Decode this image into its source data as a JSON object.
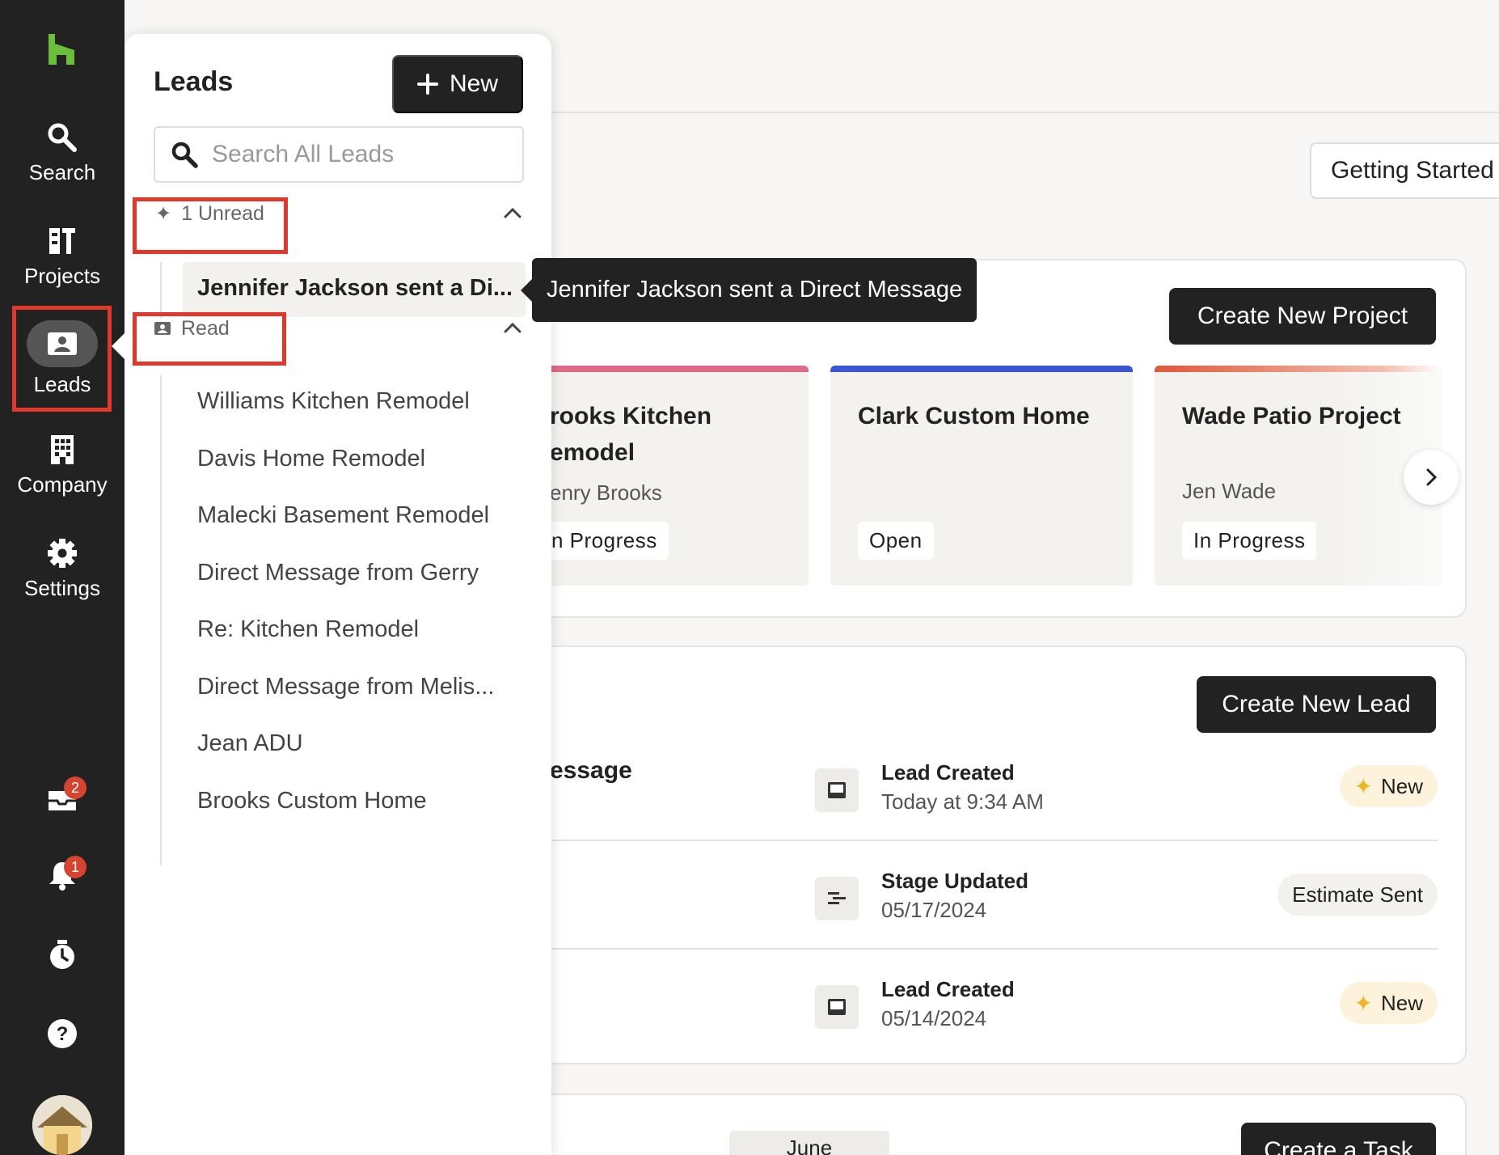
{
  "rail": {
    "items": [
      {
        "label": "Search",
        "icon": "search-icon"
      },
      {
        "label": "Projects",
        "icon": "projects-icon"
      },
      {
        "label": "Leads",
        "icon": "leads-icon"
      },
      {
        "label": "Company",
        "icon": "building-icon"
      },
      {
        "label": "Settings",
        "icon": "gear-icon"
      }
    ],
    "inbox_badge": "2",
    "bell_badge": "1"
  },
  "main": {
    "getting_started": "Getting Started",
    "create_project": "Create New Project",
    "create_lead": "Create New Lead",
    "create_task": "Create a Task",
    "month_tab": "June",
    "partial_message": "essage",
    "projects": [
      {
        "name": "Brooks Kitchen Remodel",
        "name_visible_1": "rooks Kitchen",
        "name_visible_2": "emodel",
        "client": "enry Brooks",
        "status": "n Progress",
        "bar_color": "#e06a8a"
      },
      {
        "name": "Clark Custom Home",
        "client": "",
        "status": "Open",
        "bar_color": "#3a55d6"
      },
      {
        "name": "Wade Patio Project",
        "client": "Jen Wade",
        "status": "In Progress",
        "bar_color": "#e0573a"
      }
    ],
    "activity": [
      {
        "title": "Lead Created",
        "sub": "Today at 9:34 AM",
        "tag": "New"
      },
      {
        "title": "Stage Updated",
        "sub": "05/17/2024",
        "tag": "Estimate Sent"
      },
      {
        "title": "Lead Created",
        "sub": "05/14/2024",
        "tag": "New"
      }
    ]
  },
  "panel": {
    "title": "Leads",
    "new_label": "New",
    "search_placeholder": "Search All Leads",
    "unread_group": "1 Unread",
    "read_group": "Read",
    "unread_items": [
      "Jennifer Jackson sent a Di..."
    ],
    "read_items": [
      "Williams Kitchen Remodel",
      "Davis Home Remodel",
      "Malecki Basement Remodel",
      "Direct Message from Gerry",
      "Re: Kitchen Remodel",
      "Direct Message from Melis...",
      "Jean ADU",
      "Brooks Custom Home"
    ]
  },
  "tooltip": "Jennifer Jackson sent a Direct Message",
  "colors": {
    "accent_green": "#6bbf3a",
    "highlight_red": "#e0392c",
    "dark": "#222222",
    "badge_red": "#d5442f",
    "new_tag_bg": "#fdf3dd"
  }
}
